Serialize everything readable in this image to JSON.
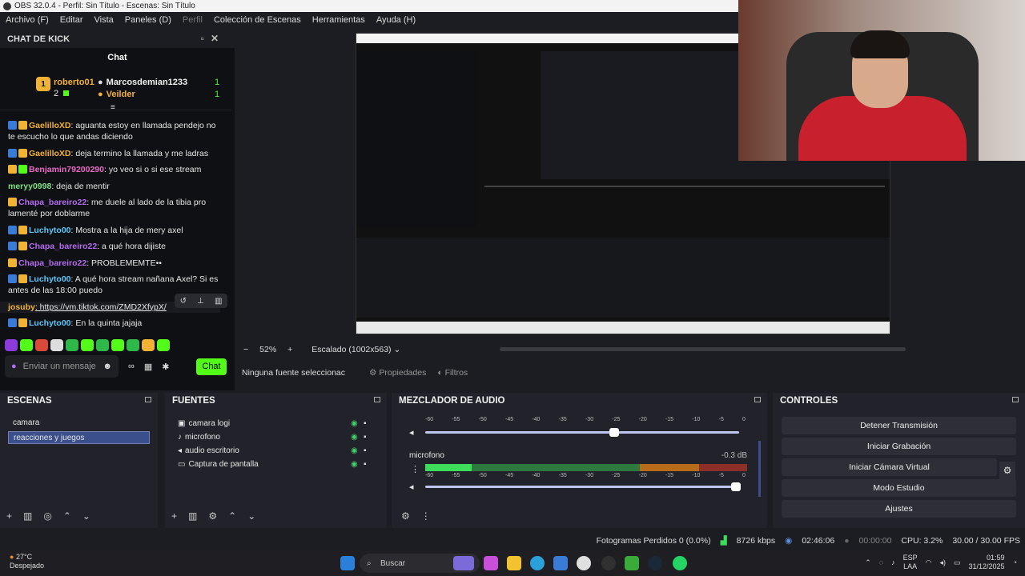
{
  "window": {
    "title": "OBS 32.0.4 - Perfil: Sin Título - Escenas: Sin Título"
  },
  "menu": [
    "Archivo (F)",
    "Editar",
    "Vista",
    "Paneles (D)",
    "Perfil",
    "Colección de Escenas",
    "Herramientas",
    "Ayuda (H)"
  ],
  "chat_dock": {
    "title": "CHAT DE KICK",
    "tab": "Chat",
    "leaderboard": [
      {
        "name": "roberto01",
        "count": "2"
      },
      {
        "name": "Marcosdemian1233",
        "count": "1"
      },
      {
        "name": "Veilder",
        "count": "1"
      }
    ],
    "messages": [
      {
        "user": "GaelilloXD",
        "text": ": aguanta estoy en llamada pendejo no te escucho lo que andas diciendo"
      },
      {
        "user": "GaelilloXD",
        "text": ": deja termino la llamada y me ladras"
      },
      {
        "user": "Benjamin79200290",
        "text": ": yo veo si o si ese stream"
      },
      {
        "user": "meryy0998",
        "text": ": deja de mentir"
      },
      {
        "user": "Chapa_bareiro22",
        "text": ": me duele al lado de la tibia pro lamenté por doblarme"
      },
      {
        "user": "Luchyto00",
        "text": ": Mostra a la hija de mery axel"
      },
      {
        "user": "Chapa_bareiro22",
        "text": ": a qué hora dijiste"
      },
      {
        "user": "Chapa_bareiro22",
        "text": ": PROBLEMEMTE••"
      },
      {
        "user": "Luchyto00",
        "text": ": A qué hora stream nañana Axel? Si es antes de las 18:00 puedo"
      },
      {
        "user": "josuby",
        "text": ": https://vm.tiktok.com/ZMD2XfypX/"
      },
      {
        "user": "Luchyto00",
        "text": ": En la quinta jajaja"
      }
    ],
    "input_placeholder": "Enviar un mensaje",
    "send_label": "Chat"
  },
  "preview": {
    "zoom": "52%",
    "scale": "Escalado (1002x563)"
  },
  "source_toolbar": {
    "no_source": "Ninguna fuente seleccionac",
    "properties": "Propiedades",
    "filters": "Filtros"
  },
  "scenes": {
    "title": "ESCENAS",
    "items": [
      "camara",
      "reacciones y juegos"
    ]
  },
  "sources": {
    "title": "FUENTES",
    "items": [
      "camara logi",
      "microfono",
      "audio escritorio",
      "Captura de pantalla"
    ]
  },
  "mixer": {
    "title": "MEZCLADOR DE AUDIO",
    "scale": [
      "-60",
      "-55",
      "-50",
      "-45",
      "-40",
      "-35",
      "-30",
      "-25",
      "-20",
      "-15",
      "-10",
      "-5",
      "0"
    ],
    "channel_name": "microfono",
    "channel_db": "-0.3 dB"
  },
  "controls": {
    "title": "CONTROLES",
    "buttons": [
      "Detener Transmisión",
      "Iniciar Grabación",
      "Iniciar Cámara Virtual",
      "Modo Estudio",
      "Ajustes"
    ]
  },
  "status": {
    "dropped": "Fotogramas Perdidos 0 (0.0%)",
    "bitrate": "8726 kbps",
    "stream_time": "02:46:06",
    "rec_time": "00:00:00",
    "cpu": "CPU: 3.2%",
    "fps": "30.00 / 30.00 FPS"
  },
  "taskbar": {
    "temp": "27°C",
    "weather": "Despejado",
    "search": "Buscar",
    "lang": "ESP",
    "lang2": "LAA",
    "time": "01:59",
    "date": "31/12/2025"
  },
  "colors": {
    "kick_green": "#53fc18",
    "accent": "#3b4f8c"
  }
}
